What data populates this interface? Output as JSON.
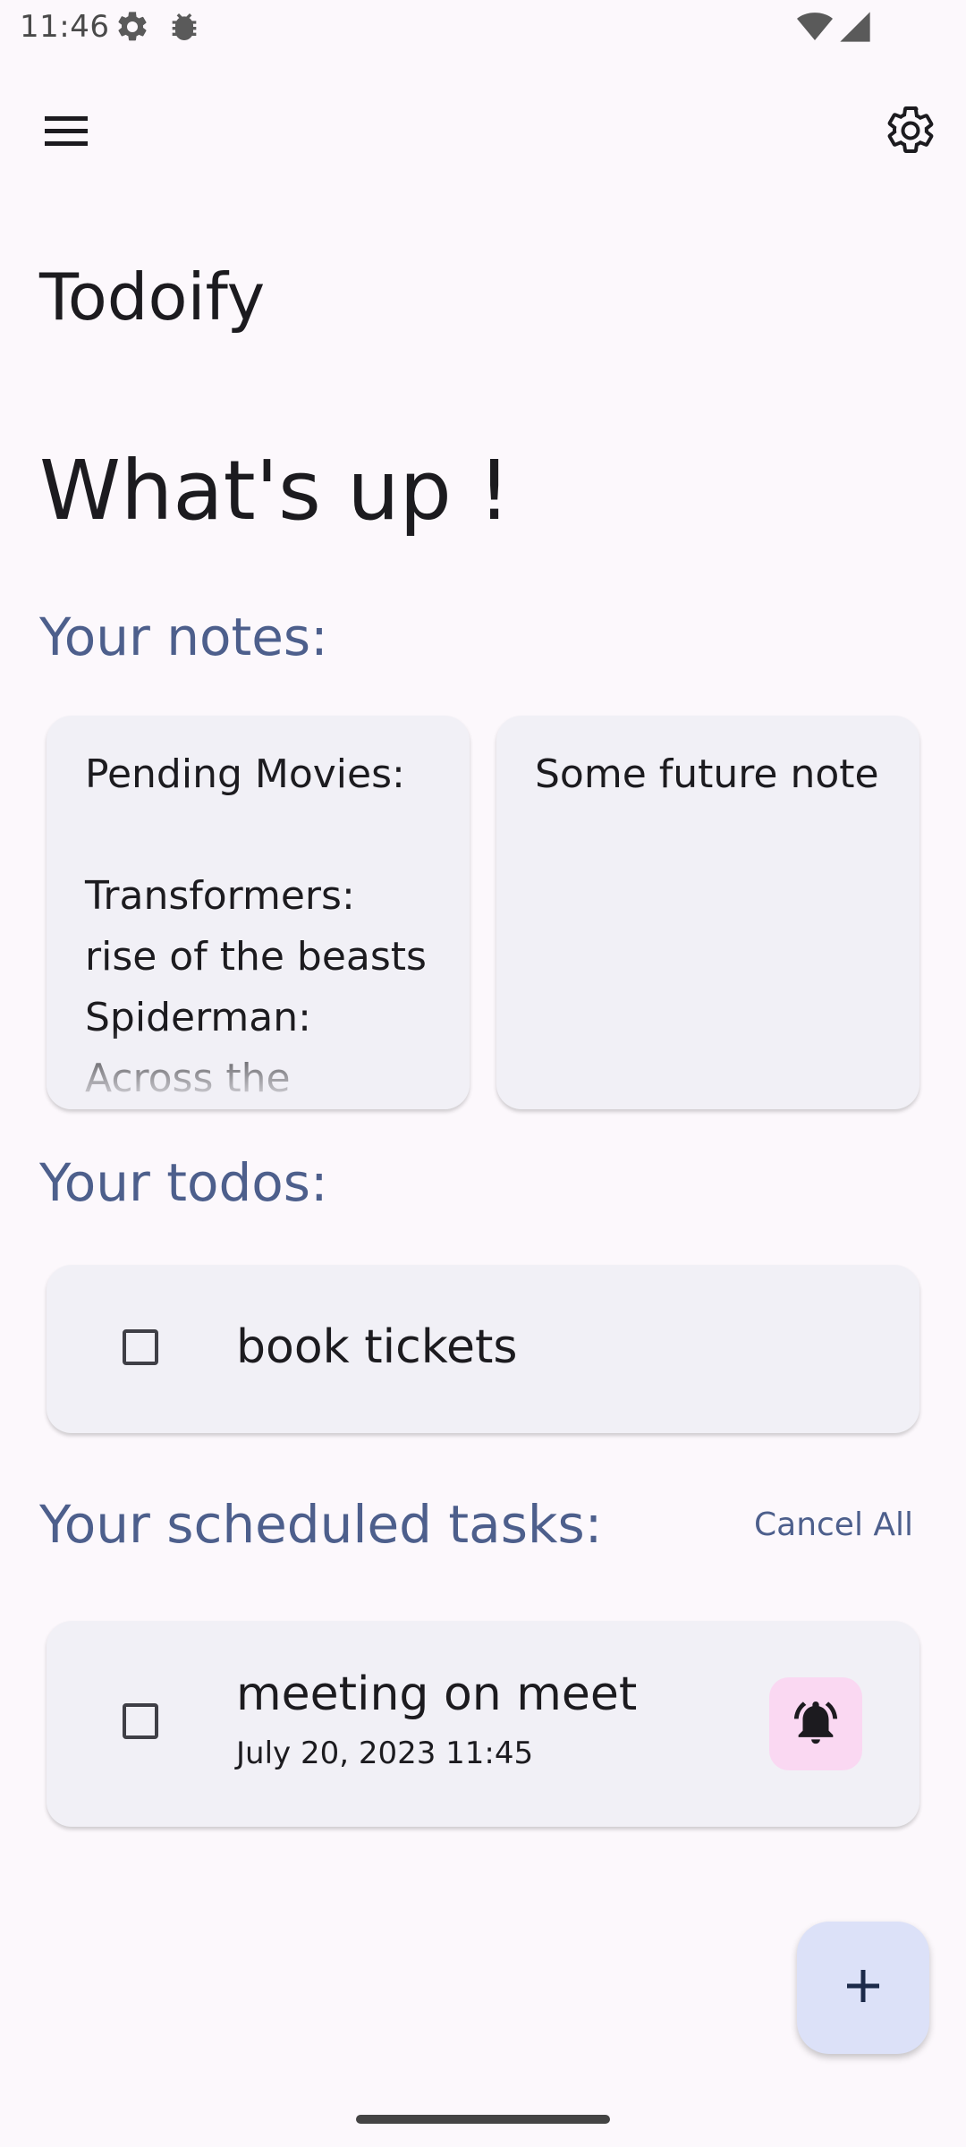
{
  "status_bar": {
    "time": "11:46",
    "icons": [
      "settings-gear-icon",
      "bug-icon",
      "wifi-icon",
      "signal-icon"
    ]
  },
  "app_bar": {
    "menu_icon": "hamburger-menu-icon",
    "settings_icon": "gear-icon"
  },
  "app_title": "Todoify",
  "greeting": "What's up !",
  "notes": {
    "heading": "Your notes:",
    "items": [
      {
        "text": "Pending Movies:\n\nTransformers:\nrise of the beasts\nSpiderman:\nAcross the"
      },
      {
        "text": "Some future note"
      }
    ]
  },
  "todos": {
    "heading": "Your todos:",
    "items": [
      {
        "label": "book tickets",
        "checked": false
      }
    ]
  },
  "scheduled": {
    "heading": "Your scheduled tasks:",
    "cancel_all_label": "Cancel All",
    "items": [
      {
        "label": "meeting on meet",
        "date": "July 20, 2023 11:45",
        "checked": false,
        "bell_icon": "bell-ringing-icon"
      }
    ]
  },
  "fab": {
    "icon": "plus-icon"
  },
  "colors": {
    "background": "#fcf8fc",
    "accent": "#4d5f8c",
    "card": "#f1f0f6",
    "bell_button": "#fad8f2",
    "fab": "#dce1f8"
  }
}
